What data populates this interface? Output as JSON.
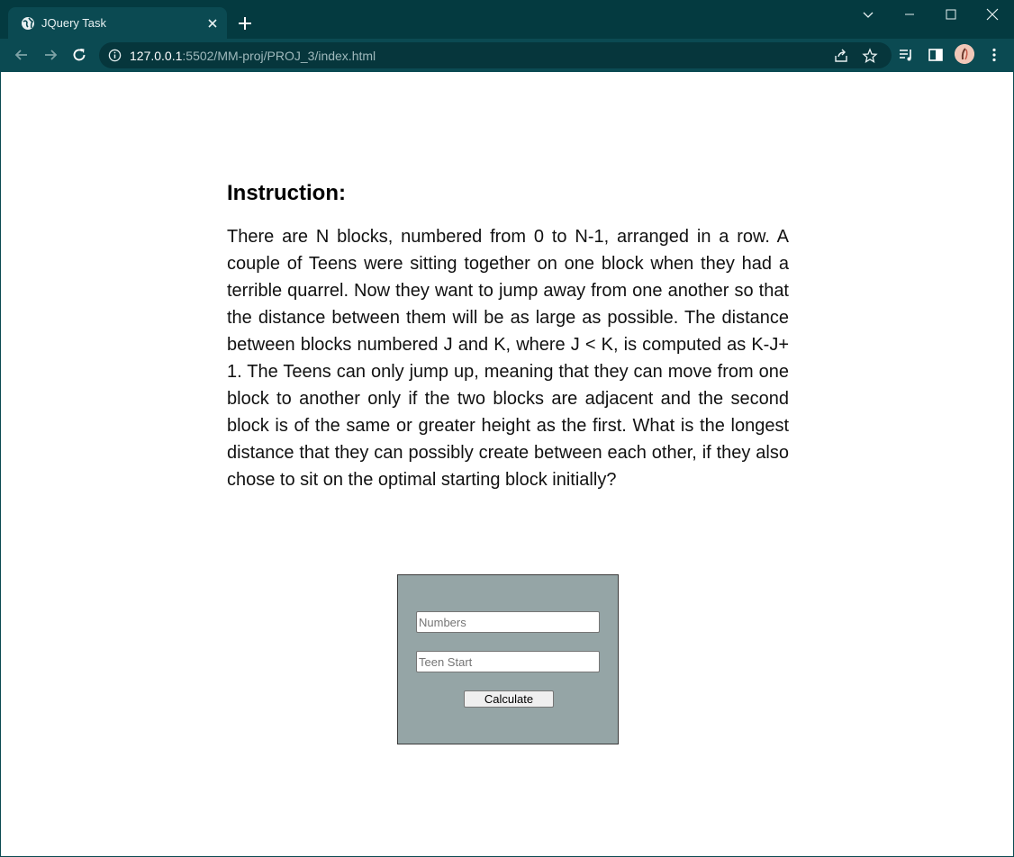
{
  "browser": {
    "tab_title": "JQuery Task",
    "url_host": "127.0.0.1",
    "url_rest": ":5502/MM-proj/PROJ_3/index.html"
  },
  "page": {
    "heading": "Instruction:",
    "instruction_text": "There are N blocks, numbered from 0 to N-1, arranged in a row. A couple of Teens were sitting together on one block when they had a terrible quarrel. Now they want to jump away from one another so that the distance between them will be as large as possible. The distance between blocks numbered J and K, where J < K, is computed as K-J+ 1. The Teens can only jump up, meaning that they can move from one block to another only if the two blocks are adjacent and the second block is of the same or greater height as the first. What is the longest distance that they can possibly create between each other, if they also chose to sit on the optimal starting block initially?",
    "form": {
      "numbers_placeholder": "Numbers",
      "numbers_value": "",
      "teen_start_placeholder": "Teen Start",
      "teen_start_value": "",
      "calculate_label": "Calculate"
    }
  },
  "colors": {
    "tabstrip": "#043a40",
    "toolbar": "#0b4a52",
    "form_panel": "#95a5a6"
  }
}
